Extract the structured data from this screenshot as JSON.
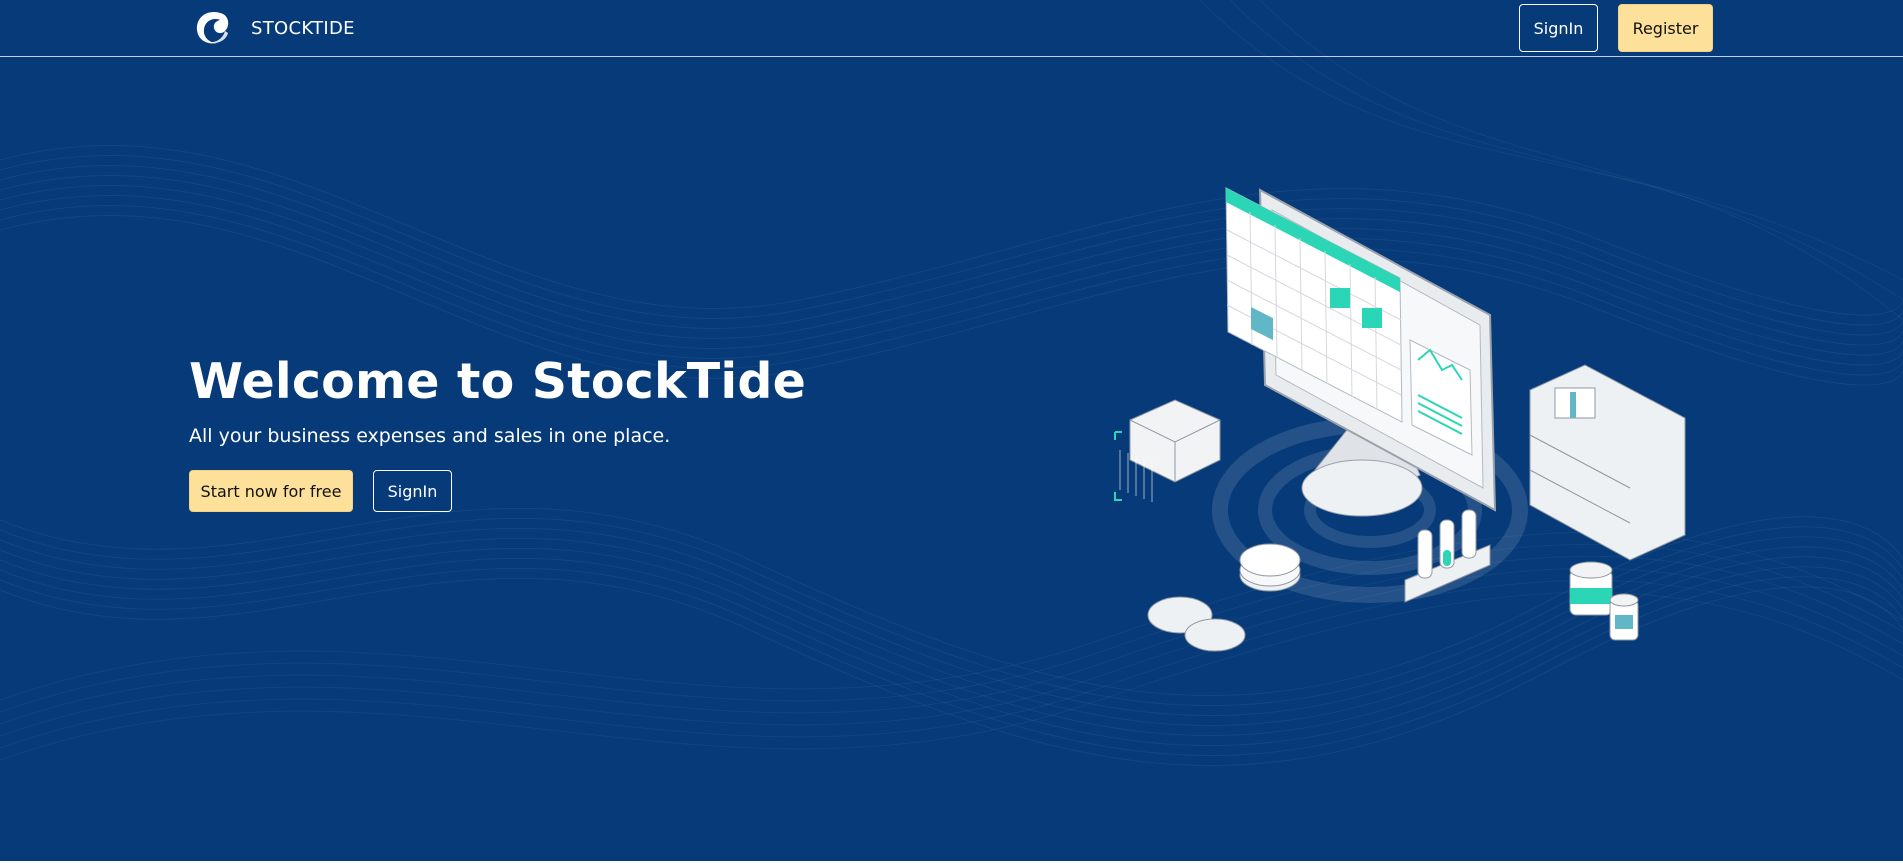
{
  "app": {
    "brand_name": "STOCKTIDE",
    "logo_icon": "wave-logo-icon"
  },
  "nav": {
    "signin_label": "SignIn",
    "register_label": "Register"
  },
  "hero": {
    "title": "Welcome to StockTide",
    "subtitle": "All your business expenses and sales in one place.",
    "primary_cta_label": "Start now for free",
    "secondary_cta_label": "SignIn",
    "illustration_icon": "inventory-dashboard-illustration"
  },
  "colors": {
    "background": "#063a78",
    "accent_yellow": "#fde19a",
    "accent_teal": "#2ad6b5",
    "text_light": "#ffffff"
  }
}
